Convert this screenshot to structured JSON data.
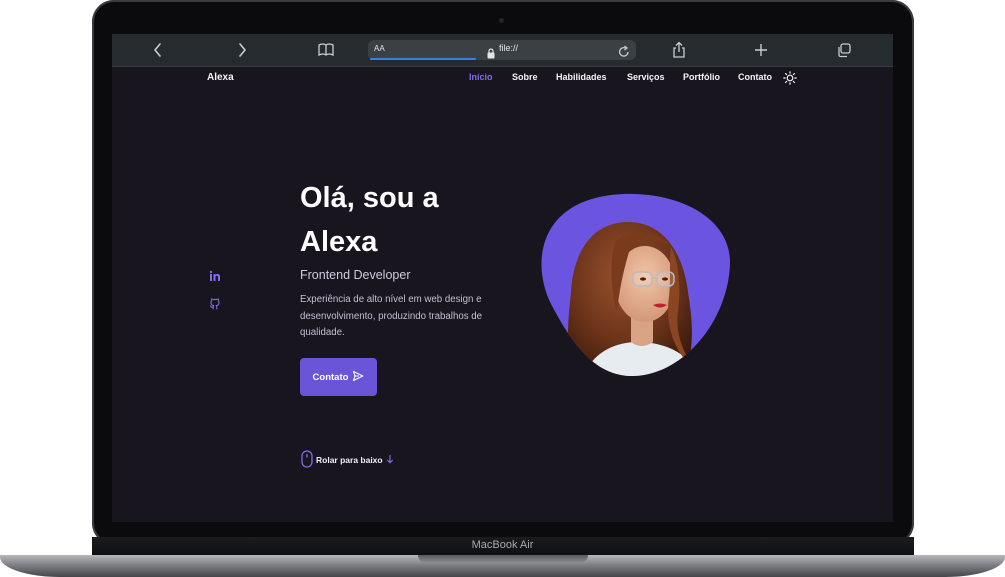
{
  "device": {
    "model_label": "MacBook Air"
  },
  "browser": {
    "text_size_label": "AA",
    "url": "file://"
  },
  "site": {
    "logo": "Alexa",
    "nav": [
      {
        "label": "Início",
        "active": true
      },
      {
        "label": "Sobre",
        "active": false
      },
      {
        "label": "Habilidades",
        "active": false
      },
      {
        "label": "Serviços",
        "active": false
      },
      {
        "label": "Portfólio",
        "active": false
      },
      {
        "label": "Contato",
        "active": false
      }
    ],
    "theme_icon": "sun-icon",
    "socials": [
      "linkedin-icon",
      "github-icon"
    ],
    "hero": {
      "title_line1": "Olá, sou a",
      "title_line2": "Alexa",
      "subtitle": "Frontend Developer",
      "description": "Experiência de alto nível em web design e desenvolvimento, produzindo trabalhos de qualidade.",
      "cta_label": "Contato",
      "scroll_label": "Rolar para baixo"
    },
    "colors": {
      "accent": "#6a55d8",
      "background": "#18151f",
      "text": "#ffffff"
    }
  }
}
